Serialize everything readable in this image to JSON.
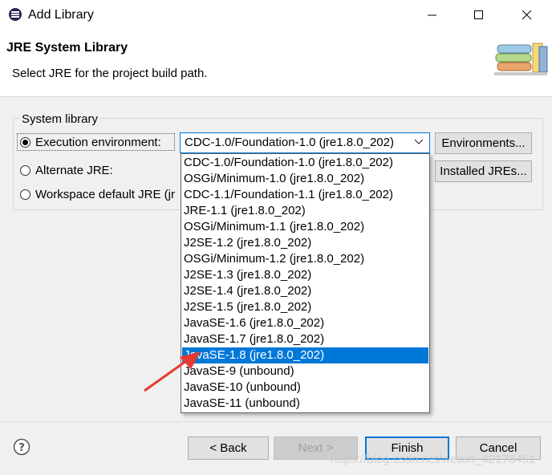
{
  "window": {
    "title": "Add Library",
    "controls": {
      "minimize_icon": "minimize-icon",
      "maximize_icon": "maximize-icon",
      "close_icon": "close-icon"
    }
  },
  "header": {
    "title": "JRE System Library",
    "description": "Select JRE for the project build path."
  },
  "group": {
    "label": "System library",
    "exec_env_label": "Execution environment:",
    "alternate_label": "Alternate JRE:",
    "workspace_label": "Workspace default JRE (jr",
    "selected_option": "exec_env"
  },
  "combo": {
    "value": "CDC-1.0/Foundation-1.0 (jre1.8.0_202)",
    "options": [
      "CDC-1.0/Foundation-1.0 (jre1.8.0_202)",
      "OSGi/Minimum-1.0 (jre1.8.0_202)",
      "CDC-1.1/Foundation-1.1 (jre1.8.0_202)",
      "JRE-1.1 (jre1.8.0_202)",
      "OSGi/Minimum-1.1 (jre1.8.0_202)",
      "J2SE-1.2 (jre1.8.0_202)",
      "OSGi/Minimum-1.2 (jre1.8.0_202)",
      "J2SE-1.3 (jre1.8.0_202)",
      "J2SE-1.4 (jre1.8.0_202)",
      "J2SE-1.5 (jre1.8.0_202)",
      "JavaSE-1.6 (jre1.8.0_202)",
      "JavaSE-1.7 (jre1.8.0_202)",
      "JavaSE-1.8 (jre1.8.0_202)",
      "JavaSE-9 (unbound)",
      "JavaSE-10 (unbound)",
      "JavaSE-11 (unbound)"
    ],
    "highlighted": "JavaSE-1.8 (jre1.8.0_202)"
  },
  "buttons": {
    "environments": "Environments...",
    "installed_jres": "Installed JREs...",
    "back": "< Back",
    "next": "Next >",
    "finish": "Finish",
    "cancel": "Cancel"
  },
  "watermark": "https://blog.csdn.net/weixin_42173451",
  "colors": {
    "selection": "#0078d7",
    "annotation_arrow": "#e8392f"
  }
}
